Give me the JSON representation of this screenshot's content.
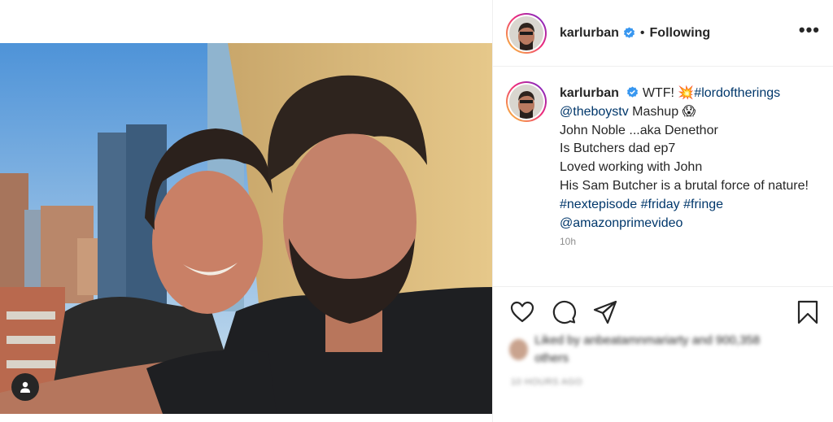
{
  "post": {
    "username": "karlurban",
    "following_label": "Following",
    "more_label": "•••",
    "separator": "•"
  },
  "caption": {
    "username": "karlurban",
    "line1_text": "WTF! 💥",
    "hashtag_lotr": "#lordoftherings",
    "mention_theboys": "@theboystv",
    "mashup_text": " Mashup 😱",
    "lines": [
      "John Noble ...aka Denethor",
      "Is Butchers dad ep7",
      "Loved working with John",
      "His Sam Butcher is a brutal force of nature!"
    ],
    "hashtags": [
      "#nextepisode",
      "#friday",
      "#fringe"
    ],
    "mention_amazon": "@amazonprimevideo",
    "time_partial": "10h"
  },
  "likes": {
    "text": "Liked by anbeatamnmariarty and 900,358 others",
    "time": "10 HOURS AGO"
  },
  "icons": {
    "like": "heart-icon",
    "comment": "comment-icon",
    "share": "share-icon",
    "save": "bookmark-icon",
    "verified": "verified-badge-icon",
    "tag": "user-tag-icon"
  },
  "colors": {
    "link": "#00376b",
    "verified": "#3897f0",
    "text": "#262626",
    "muted": "#8e8e8e"
  }
}
